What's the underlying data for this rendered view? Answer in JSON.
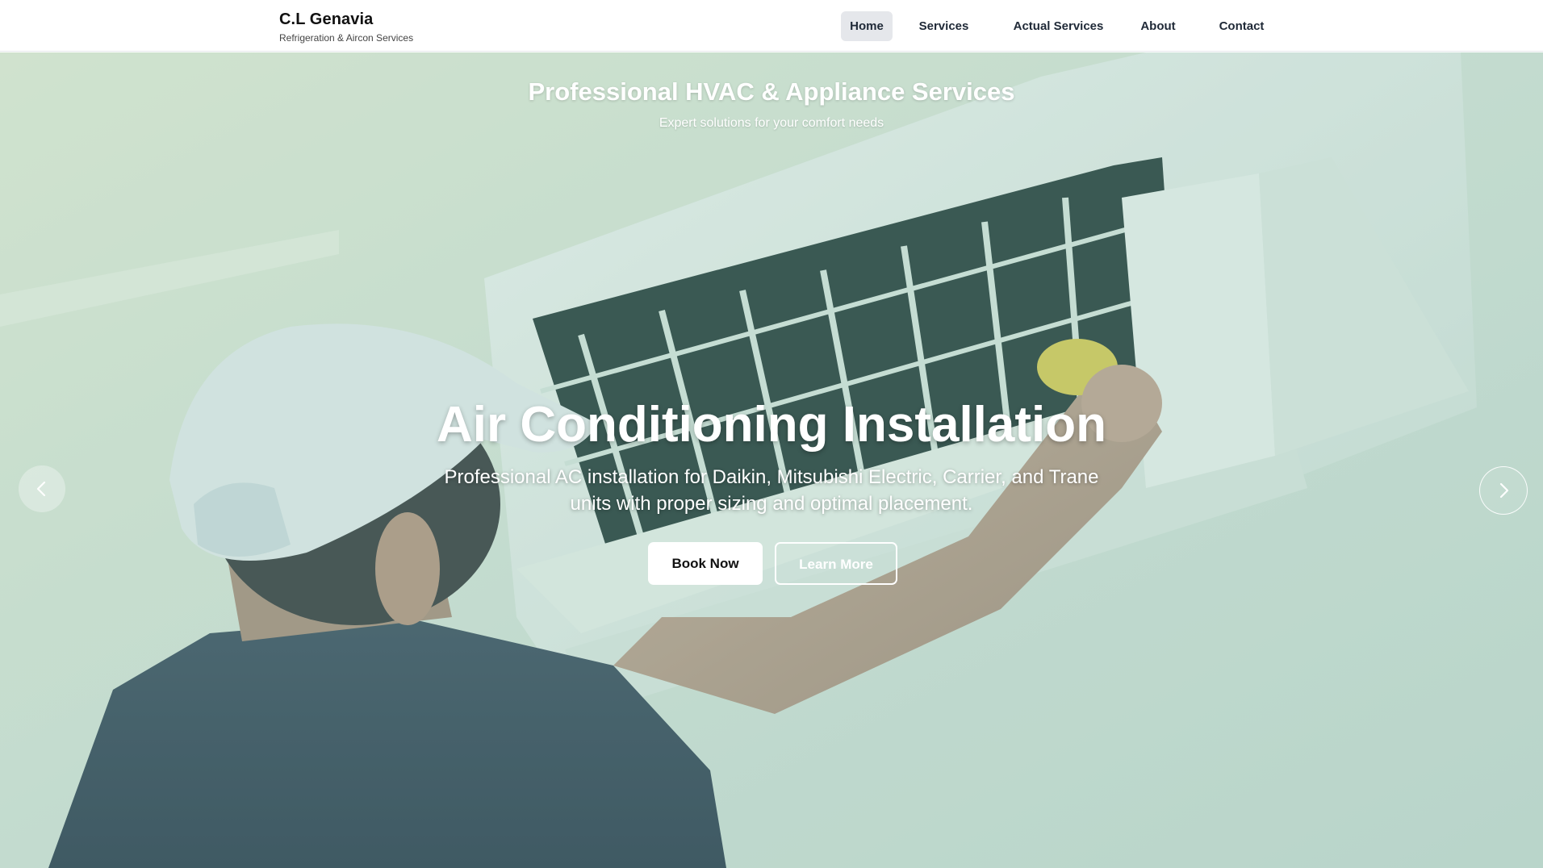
{
  "brand": {
    "name": "C.L Genavia",
    "tagline": "Refrigeration & Aircon Services"
  },
  "nav": {
    "items": [
      {
        "label": "Home",
        "active": true
      },
      {
        "label": "Services",
        "active": false
      },
      {
        "label": "Actual Services",
        "active": false
      },
      {
        "label": "About",
        "active": false
      },
      {
        "label": "Contact",
        "active": false
      }
    ]
  },
  "hero": {
    "heading": "Professional HVAC & Appliance Services",
    "subheading": "Expert solutions for your comfort needs",
    "slide": {
      "title": "Air Conditioning Installation",
      "description": "Professional AC installation for Daikin, Mitsubishi Electric, Carrier, and Trane units with proper sizing and optimal placement.",
      "primary_button": "Book Now",
      "secondary_button": "Learn More"
    },
    "prev_icon": "chevron-left-icon",
    "next_icon": "chevron-right-icon"
  },
  "colors": {
    "header_bg": "#ffffff",
    "active_nav_bg": "#e5e7eb",
    "hero_overlay": "#96c4b4",
    "text_on_hero": "#ffffff"
  }
}
